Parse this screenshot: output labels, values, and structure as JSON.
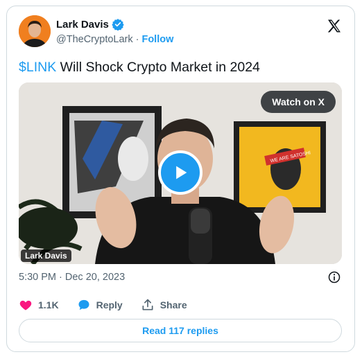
{
  "author": {
    "display_name": "Lark Davis",
    "handle": "@TheCryptoLark",
    "separator": "·",
    "follow_label": "Follow"
  },
  "tweet": {
    "cashtag": "$LINK",
    "text": " Will Shock Crypto Market in 2024"
  },
  "media": {
    "watch_label": "Watch on X",
    "video_label": "Lark Davis",
    "poster_text": "WE ARE SATOSHI"
  },
  "meta": {
    "timestamp": "5:30 PM · Dec 20, 2023"
  },
  "actions": {
    "likes": "1.1K",
    "reply_label": "Reply",
    "share_label": "Share"
  },
  "footer": {
    "read_replies_label": "Read 117 replies"
  },
  "colors": {
    "accent": "#1d9bf0",
    "like": "#f91880",
    "text_primary": "#0f1419",
    "text_secondary": "#536471",
    "avatar_bg": "#f07f1f"
  },
  "icons": {
    "verified": "verified-badge-icon",
    "logo": "x-logo-icon",
    "info": "info-icon",
    "like": "heart-icon",
    "reply": "speech-bubble-icon",
    "share": "share-icon",
    "play": "play-icon"
  }
}
